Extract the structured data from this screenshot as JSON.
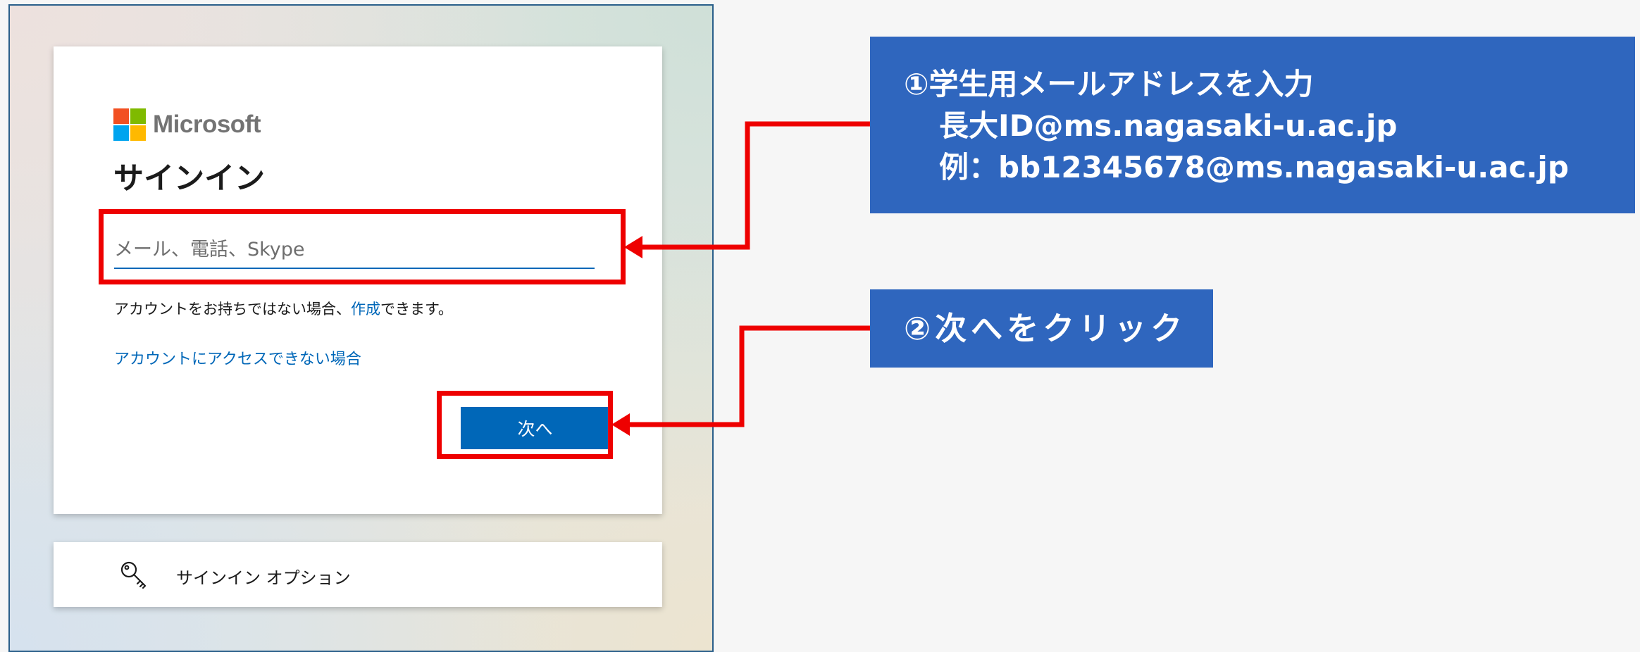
{
  "brand": {
    "name": "Microsoft",
    "logo_colors": [
      "#f25022",
      "#7fba00",
      "#00a4ef",
      "#ffb900"
    ]
  },
  "signin": {
    "title": "サインイン",
    "email_placeholder": "メール、電話、Skype",
    "email_value": "",
    "no_account_prefix": "アカウントをお持ちではない場合、",
    "create_link": "作成",
    "no_account_suffix": "できます。",
    "cant_access_link": "アカウントにアクセスできない場合",
    "next_button": "次へ"
  },
  "options": {
    "label": "サインイン オプション",
    "icon": "key-icon"
  },
  "annotations": {
    "step1": {
      "line1": "①学生用メールアドレスを入力",
      "line2": "長大ID@ms.nagasaki-u.ac.jp",
      "line3": "例：bb12345678@ms.nagasaki-u.ac.jp"
    },
    "step2": {
      "text": "②次へをクリック"
    },
    "highlight_color": "#ee0000",
    "callout_color": "#2f66be"
  },
  "colors": {
    "accent": "#0067b8",
    "panel_border": "#2a5f8a"
  }
}
